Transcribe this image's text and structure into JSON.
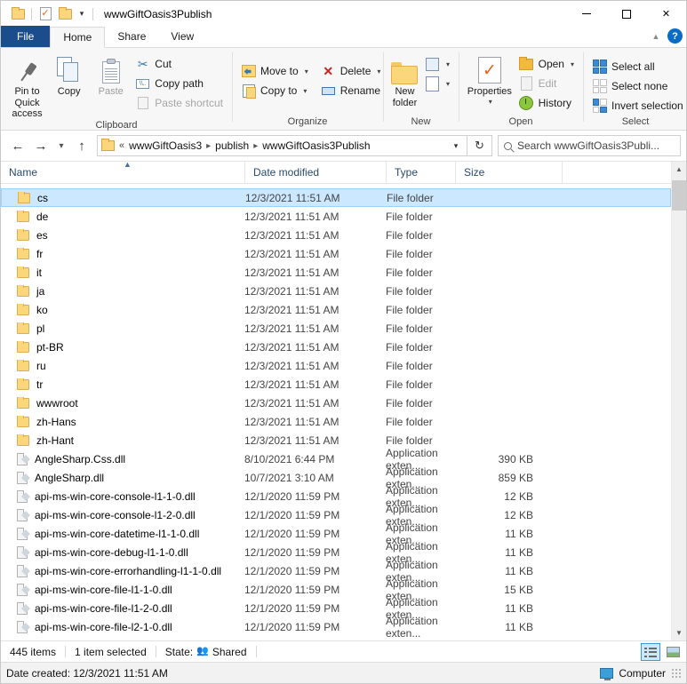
{
  "window": {
    "title": "wwwGiftOasis3Publish",
    "minimize_label": "Minimize",
    "maximize_label": "Maximize",
    "close_label": "Close"
  },
  "quick_access_toolbar": {
    "folder_label": "Folder",
    "properties_label": "Properties",
    "new_folder_label": "New folder",
    "customize_label": "Customize Quick Access Toolbar"
  },
  "tabs": [
    {
      "label": "File",
      "id": "file"
    },
    {
      "label": "Home",
      "id": "home"
    },
    {
      "label": "Share",
      "id": "share"
    },
    {
      "label": "View",
      "id": "view"
    }
  ],
  "tab_right": {
    "collapse_label": "Collapse the Ribbon",
    "help_label": "?"
  },
  "ribbon": {
    "groups": [
      {
        "name": "Clipboard",
        "label": "Clipboard",
        "big_buttons": [
          {
            "label": "Pin to Quick access",
            "icon": "pin-icon",
            "enabled": true
          },
          {
            "label": "Copy",
            "icon": "copy-icon",
            "enabled": true
          },
          {
            "label": "Paste",
            "icon": "paste-icon",
            "enabled": false
          }
        ],
        "small_buttons": [
          {
            "label": "Cut",
            "icon": "scissors-icon",
            "enabled": true
          },
          {
            "label": "Copy path",
            "icon": "copy-path-icon",
            "enabled": true
          },
          {
            "label": "Paste shortcut",
            "icon": "paste-shortcut-icon",
            "enabled": false
          }
        ]
      },
      {
        "name": "Organize",
        "label": "Organize",
        "small_buttons": [
          {
            "label": "Move to",
            "icon": "move-to-icon",
            "dropdown": true
          },
          {
            "label": "Copy to",
            "icon": "copy-to-icon",
            "dropdown": true
          },
          {
            "label": "Delete",
            "icon": "delete-icon",
            "dropdown": true
          },
          {
            "label": "Rename",
            "icon": "rename-icon",
            "dropdown": false
          }
        ]
      },
      {
        "name": "New",
        "label": "New",
        "big_buttons": [
          {
            "label": "New folder",
            "icon": "new-folder-icon",
            "enabled": true
          }
        ],
        "small_buttons": [
          {
            "label": "",
            "icon": "new-item-icon",
            "dropdown": true
          },
          {
            "label": "",
            "icon": "easy-access-icon",
            "dropdown": true
          }
        ]
      },
      {
        "name": "Open",
        "label": "Open",
        "big_buttons": [
          {
            "label": "Properties",
            "icon": "properties-icon",
            "enabled": true,
            "dropdown": true
          }
        ],
        "small_buttons": [
          {
            "label": "Open",
            "icon": "open-icon",
            "dropdown": true,
            "enabled": true
          },
          {
            "label": "Edit",
            "icon": "edit-icon",
            "enabled": false
          },
          {
            "label": "History",
            "icon": "history-icon",
            "enabled": true
          }
        ]
      },
      {
        "name": "Select",
        "label": "Select",
        "small_buttons": [
          {
            "label": "Select all",
            "icon": "select-all-icon"
          },
          {
            "label": "Select none",
            "icon": "select-none-icon"
          },
          {
            "label": "Invert selection",
            "icon": "invert-selection-icon"
          }
        ]
      }
    ]
  },
  "address_bar": {
    "back_label": "Back",
    "forward_label": "Forward",
    "recent_label": "Recent locations",
    "up_label": "Up",
    "prefix": "«",
    "breadcrumbs": [
      "wwwGiftOasis3",
      "publish",
      "wwwGiftOasis3Publish"
    ],
    "dropdown_label": "Previous locations",
    "refresh_label": "Refresh"
  },
  "search": {
    "placeholder": "Search wwwGiftOasis3Publi...",
    "icon": "search-icon"
  },
  "columns": [
    {
      "key": "name",
      "label": "Name",
      "sorted": "asc"
    },
    {
      "key": "date",
      "label": "Date modified"
    },
    {
      "key": "type",
      "label": "Type"
    },
    {
      "key": "size",
      "label": "Size"
    }
  ],
  "files": [
    {
      "name": "cs",
      "date": "12/3/2021 11:51 AM",
      "type": "File folder",
      "size": "",
      "icon": "folder-icon",
      "selected": true
    },
    {
      "name": "de",
      "date": "12/3/2021 11:51 AM",
      "type": "File folder",
      "size": "",
      "icon": "folder-icon",
      "selected": false
    },
    {
      "name": "es",
      "date": "12/3/2021 11:51 AM",
      "type": "File folder",
      "size": "",
      "icon": "folder-icon",
      "selected": false
    },
    {
      "name": "fr",
      "date": "12/3/2021 11:51 AM",
      "type": "File folder",
      "size": "",
      "icon": "folder-icon",
      "selected": false
    },
    {
      "name": "it",
      "date": "12/3/2021 11:51 AM",
      "type": "File folder",
      "size": "",
      "icon": "folder-icon",
      "selected": false
    },
    {
      "name": "ja",
      "date": "12/3/2021 11:51 AM",
      "type": "File folder",
      "size": "",
      "icon": "folder-icon",
      "selected": false
    },
    {
      "name": "ko",
      "date": "12/3/2021 11:51 AM",
      "type": "File folder",
      "size": "",
      "icon": "folder-icon",
      "selected": false
    },
    {
      "name": "pl",
      "date": "12/3/2021 11:51 AM",
      "type": "File folder",
      "size": "",
      "icon": "folder-icon",
      "selected": false
    },
    {
      "name": "pt-BR",
      "date": "12/3/2021 11:51 AM",
      "type": "File folder",
      "size": "",
      "icon": "folder-icon",
      "selected": false
    },
    {
      "name": "ru",
      "date": "12/3/2021 11:51 AM",
      "type": "File folder",
      "size": "",
      "icon": "folder-icon",
      "selected": false
    },
    {
      "name": "tr",
      "date": "12/3/2021 11:51 AM",
      "type": "File folder",
      "size": "",
      "icon": "folder-icon",
      "selected": false
    },
    {
      "name": "wwwroot",
      "date": "12/3/2021 11:51 AM",
      "type": "File folder",
      "size": "",
      "icon": "folder-icon",
      "selected": false
    },
    {
      "name": "zh-Hans",
      "date": "12/3/2021 11:51 AM",
      "type": "File folder",
      "size": "",
      "icon": "folder-icon",
      "selected": false
    },
    {
      "name": "zh-Hant",
      "date": "12/3/2021 11:51 AM",
      "type": "File folder",
      "size": "",
      "icon": "folder-icon",
      "selected": false
    },
    {
      "name": "AngleSharp.Css.dll",
      "date": "8/10/2021 6:44 PM",
      "type": "Application exten...",
      "size": "390 KB",
      "icon": "dll-icon",
      "selected": false
    },
    {
      "name": "AngleSharp.dll",
      "date": "10/7/2021 3:10 AM",
      "type": "Application exten...",
      "size": "859 KB",
      "icon": "dll-icon",
      "selected": false
    },
    {
      "name": "api-ms-win-core-console-l1-1-0.dll",
      "date": "12/1/2020 11:59 PM",
      "type": "Application exten...",
      "size": "12 KB",
      "icon": "dll-icon",
      "selected": false
    },
    {
      "name": "api-ms-win-core-console-l1-2-0.dll",
      "date": "12/1/2020 11:59 PM",
      "type": "Application exten...",
      "size": "12 KB",
      "icon": "dll-icon",
      "selected": false
    },
    {
      "name": "api-ms-win-core-datetime-l1-1-0.dll",
      "date": "12/1/2020 11:59 PM",
      "type": "Application exten...",
      "size": "11 KB",
      "icon": "dll-icon",
      "selected": false
    },
    {
      "name": "api-ms-win-core-debug-l1-1-0.dll",
      "date": "12/1/2020 11:59 PM",
      "type": "Application exten...",
      "size": "11 KB",
      "icon": "dll-icon",
      "selected": false
    },
    {
      "name": "api-ms-win-core-errorhandling-l1-1-0.dll",
      "date": "12/1/2020 11:59 PM",
      "type": "Application exten...",
      "size": "11 KB",
      "icon": "dll-icon",
      "selected": false
    },
    {
      "name": "api-ms-win-core-file-l1-1-0.dll",
      "date": "12/1/2020 11:59 PM",
      "type": "Application exten...",
      "size": "15 KB",
      "icon": "dll-icon",
      "selected": false
    },
    {
      "name": "api-ms-win-core-file-l1-2-0.dll",
      "date": "12/1/2020 11:59 PM",
      "type": "Application exten...",
      "size": "11 KB",
      "icon": "dll-icon",
      "selected": false
    },
    {
      "name": "api-ms-win-core-file-l2-1-0.dll",
      "date": "12/1/2020 11:59 PM",
      "type": "Application exten...",
      "size": "11 KB",
      "icon": "dll-icon",
      "selected": false
    }
  ],
  "status_bar": {
    "item_count": "445 items",
    "selection": "1 item selected",
    "state_label": "State:",
    "state_value": "Shared",
    "state_icon": "shared-users-icon",
    "view_details_label": "Details view",
    "view_thumbnails_label": "Large icons view",
    "active_view": "details"
  },
  "details_bar": {
    "text": "Date created: 12/3/2021 11:51 AM",
    "location_label": "Computer",
    "location_icon": "computer-icon"
  },
  "colors": {
    "selection": "#cce8ff",
    "selection_border": "#99d1ff",
    "file_tab": "#1b4d8c",
    "column_header_text": "#2a4a6b",
    "folder_fill": "#fcd67a",
    "help_blue": "#0a6cc4"
  }
}
